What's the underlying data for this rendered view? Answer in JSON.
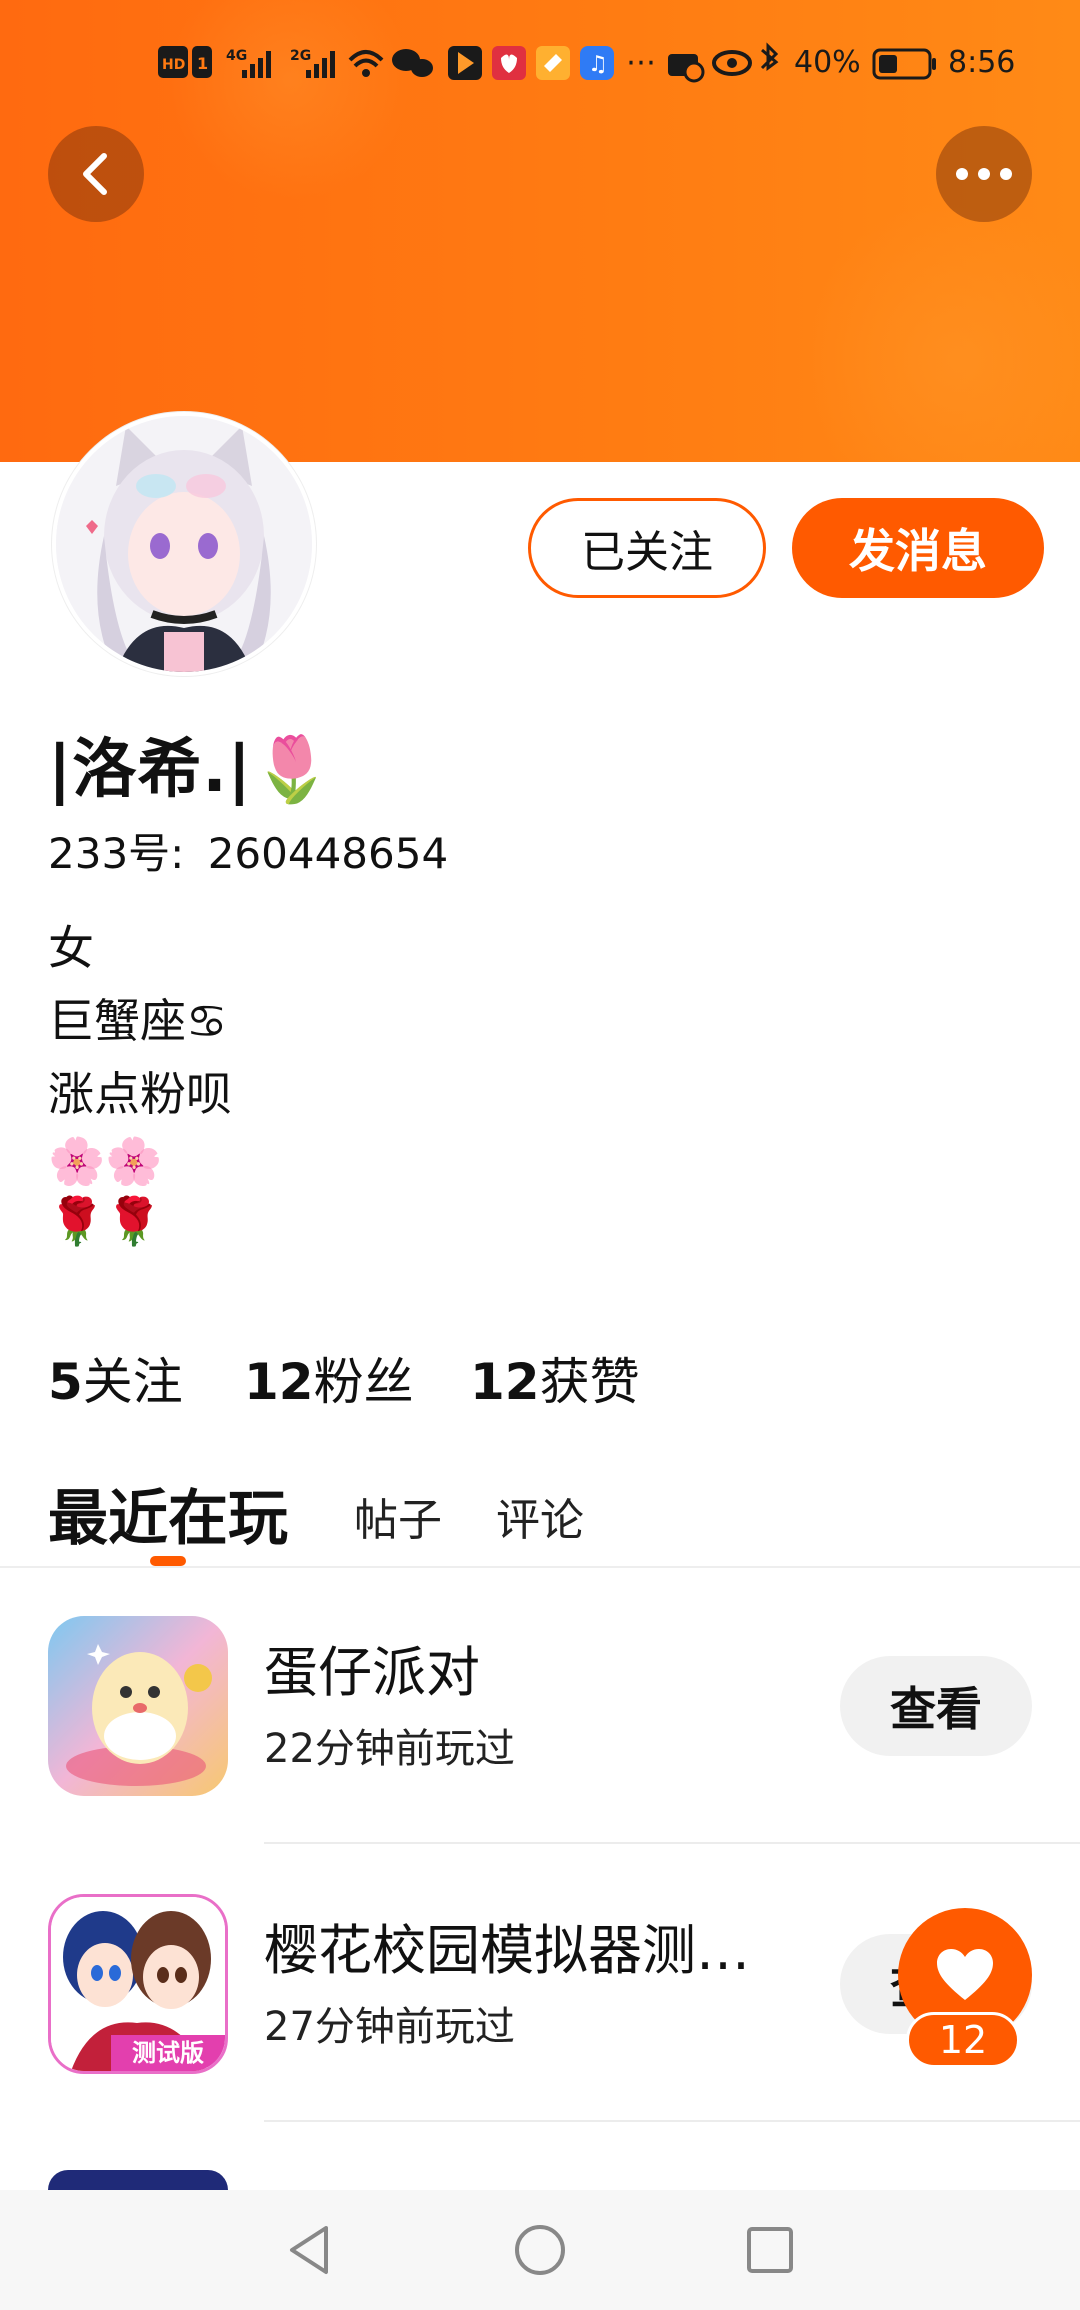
{
  "status_bar": {
    "battery_percent": "40%",
    "time": "8:56",
    "network_labels": [
      "HD",
      "1",
      "4G",
      "2G"
    ],
    "icons": [
      "signal-icon",
      "wifi-icon",
      "wechat-icon",
      "app-icon-1",
      "app-icon-2",
      "app-icon-3",
      "music-icon",
      "more-dots-icon",
      "cast-icon",
      "eye-icon",
      "bluetooth-icon",
      "battery-icon"
    ]
  },
  "header": {
    "back_icon": "chevron-left-icon",
    "more_icon": "more-horizontal-icon"
  },
  "profile": {
    "name": "|洛希.|🌷",
    "id_label": "233号:",
    "id_value": "260448654",
    "follow_button": "已关注",
    "message_button": "发消息",
    "bio_lines": [
      "女",
      "巨蟹座♋",
      "涨点粉呗",
      "🌸🌸",
      "🌹🌹"
    ]
  },
  "stats": [
    {
      "num": "5",
      "label": "关注"
    },
    {
      "num": "12",
      "label": "粉丝"
    },
    {
      "num": "12",
      "label": "获赞"
    }
  ],
  "tabs": [
    {
      "label": "最近在玩",
      "active": true
    },
    {
      "label": "帖子",
      "active": false
    },
    {
      "label": "评论",
      "active": false
    }
  ],
  "games": [
    {
      "title": "蛋仔派对",
      "subtitle": "22分钟前玩过",
      "button": "查看"
    },
    {
      "title": "樱花校园模拟器测…",
      "subtitle": "27分钟前玩过",
      "button": "查看",
      "icon_badge": "测试版"
    }
  ],
  "like_fab": {
    "icon": "heart-icon",
    "count": "12"
  },
  "nav_bar": {
    "icons": [
      "back-triangle-icon",
      "home-circle-icon",
      "recents-square-icon"
    ]
  },
  "colors": {
    "accent": "#ff5a00",
    "banner": "#ff7b12"
  }
}
